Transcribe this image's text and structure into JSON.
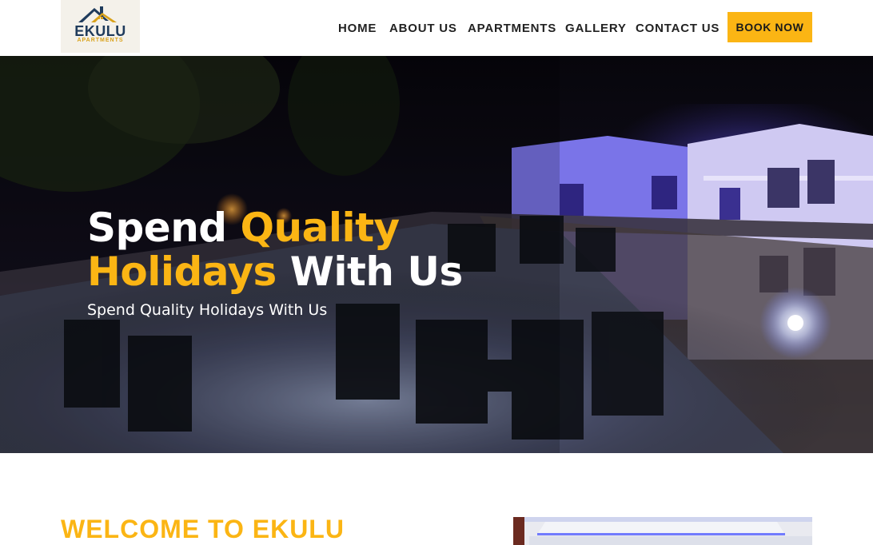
{
  "brand": {
    "name": "EKULU",
    "tagline": "APARTMENTS",
    "accent_color": "#fbb514",
    "navy_color": "#1f3b5c"
  },
  "nav": {
    "items": [
      {
        "label": "HOME"
      },
      {
        "label": "ABOUT US"
      },
      {
        "label": "APARTMENTS"
      },
      {
        "label": "GALLERY"
      },
      {
        "label": "CONTACT US"
      }
    ],
    "cta_label": "BOOK NOW"
  },
  "hero": {
    "title_part1": "Spend ",
    "title_highlight": "Quality Holidays",
    "title_part2": " With Us",
    "subtitle": "Spend Quality Holidays With Us"
  },
  "welcome": {
    "heading": "WELCOME TO EKULU"
  }
}
